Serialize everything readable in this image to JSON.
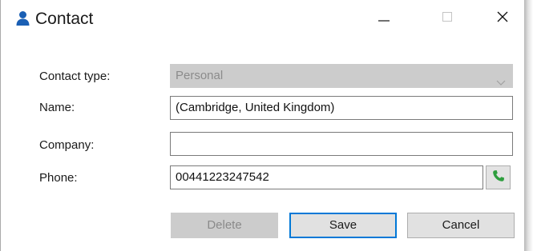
{
  "window": {
    "title": "Contact",
    "title_icon": "user-icon",
    "controls": [
      "minimize-icon",
      "maximize-icon",
      "close-icon"
    ]
  },
  "form": {
    "contact_type_label": "Contact type:",
    "contact_type_value": "Personal",
    "name_label": "Name:",
    "name_value": "(Cambridge, United Kingdom)",
    "company_label": "Company:",
    "company_value": "",
    "phone_label": "Phone:",
    "phone_value": "00441223247542",
    "call_icon": "phone-icon"
  },
  "buttons": {
    "delete_label": "Delete",
    "save_label": "Save",
    "cancel_label": "Cancel"
  },
  "colors": {
    "accent": "#0078d7",
    "user_icon": "#1a5fb4",
    "call_icon": "#2e9e3e",
    "disabled_bg": "#cccccc",
    "disabled_text": "#8a8a8a"
  }
}
